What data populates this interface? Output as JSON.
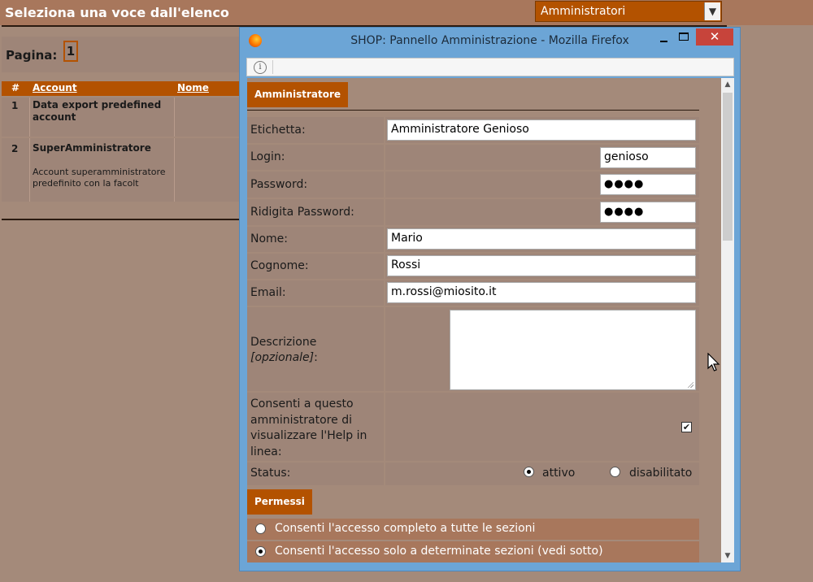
{
  "page": {
    "title": "Seleziona una voce dall'elenco",
    "select_value": "Amministratori",
    "pager_label": "Pagina:",
    "pager_current": "1",
    "table_headers": [
      "#",
      "Account",
      "Nome"
    ],
    "accounts": [
      {
        "num": "1",
        "name": "Data export predefined account",
        "description": ""
      },
      {
        "num": "2",
        "name": "SuperAmministratore",
        "description": "Account superamministratore predefinito con la facolt"
      }
    ]
  },
  "window": {
    "title": "SHOP: Pannello Amministrazione - Mozilla Firefox",
    "close_glyph": "✕",
    "info_glyph": "i"
  },
  "form": {
    "section_admin": "Amministratore",
    "etichetta_label": "Etichetta:",
    "etichetta_value": "Amministratore Genioso",
    "login_label": "Login:",
    "login_value": "genioso",
    "password_label": "Password:",
    "password_value": "●●●●",
    "ridigita_label": "Ridigita Password:",
    "ridigita_value": "●●●●",
    "nome_label": "Nome:",
    "nome_value": "Mario",
    "cognome_label": "Cognome:",
    "cognome_value": "Rossi",
    "email_label": "Email:",
    "email_value": "m.rossi@miosito.it",
    "descrizione_label": "Descrizione",
    "descrizione_optional": "[opzionale]",
    "descrizione_colon": ":",
    "descrizione_value": "",
    "help_label": "Consenti a questo amministratore di visualizzare l'Help in linea:",
    "help_checked": true,
    "status_label": "Status:",
    "status_options": [
      "attivo",
      "disabilitato"
    ],
    "status_selected": "attivo",
    "section_permessi": "Permessi",
    "perm_options": [
      "Consenti l'accesso completo a tutte le sezioni",
      "Consenti l'accesso solo a determinate sezioni (vedi sotto)"
    ],
    "perm_selected": 1,
    "check_glyph": "✔"
  },
  "colors": {
    "accent": "#b35200",
    "background": "#a48a7a",
    "titlebar": "#6ca5d6",
    "close": "#c7443b"
  }
}
